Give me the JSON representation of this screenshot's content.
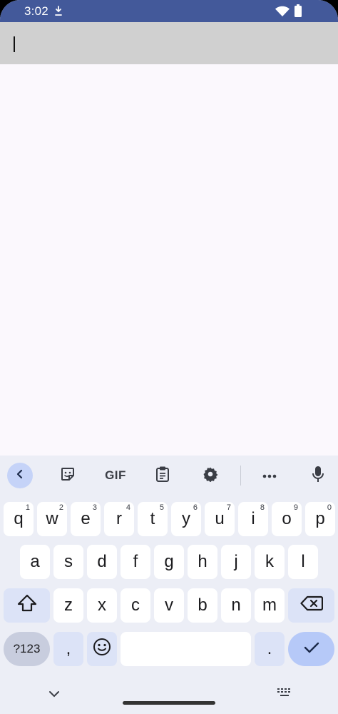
{
  "status_bar": {
    "time": "3:02"
  },
  "input": {
    "value": ""
  },
  "keyboard": {
    "row1": [
      {
        "label": "q",
        "hint": "1"
      },
      {
        "label": "w",
        "hint": "2"
      },
      {
        "label": "e",
        "hint": "3"
      },
      {
        "label": "r",
        "hint": "4"
      },
      {
        "label": "t",
        "hint": "5"
      },
      {
        "label": "y",
        "hint": "6"
      },
      {
        "label": "u",
        "hint": "7"
      },
      {
        "label": "i",
        "hint": "8"
      },
      {
        "label": "o",
        "hint": "9"
      },
      {
        "label": "p",
        "hint": "0"
      }
    ],
    "row2": [
      "a",
      "s",
      "d",
      "f",
      "g",
      "h",
      "j",
      "k",
      "l"
    ],
    "row3": [
      "z",
      "x",
      "c",
      "v",
      "b",
      "n",
      "m"
    ],
    "symbols_label": "?123",
    "comma_label": ",",
    "period_label": ".",
    "gif_label": "GIF"
  },
  "colors": {
    "status_bar_bg": "#43599a",
    "input_bg": "#d0d0d0",
    "keyboard_bg": "#eceef6",
    "accent": "#b6c9f8"
  },
  "icons": [
    "wifi-icon",
    "battery-icon",
    "download-indicator-icon",
    "back-arrow-icon",
    "sticker-icon",
    "clipboard-icon",
    "settings-gear-icon",
    "more-icon",
    "microphone-icon",
    "shift-icon",
    "backspace-icon",
    "emoji-icon",
    "checkmark-icon",
    "chevron-down-icon",
    "keyboard-switch-icon"
  ]
}
